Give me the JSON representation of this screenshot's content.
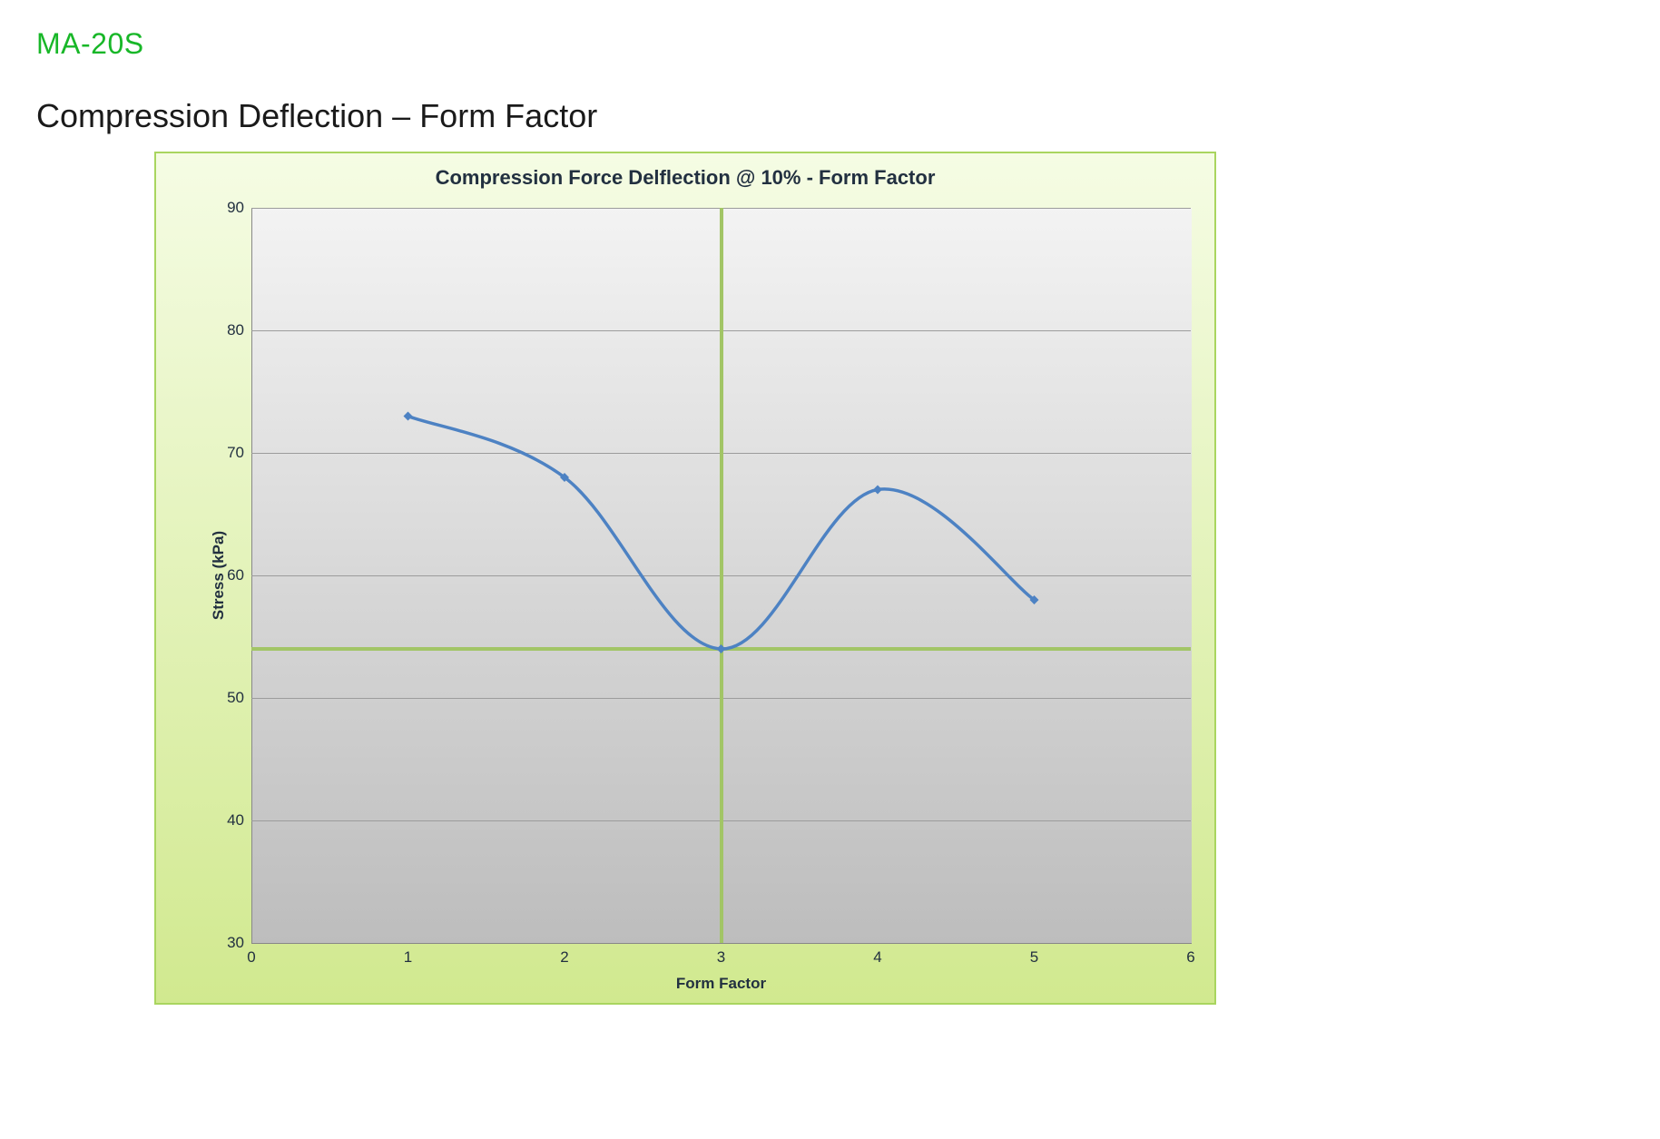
{
  "model_code": "MA-20S",
  "section_title": "Compression Deflection – Form Factor",
  "chart_data": {
    "type": "line",
    "title": "Compression Force Delflection @ 10% - Form Factor",
    "xlabel": "Form Factor",
    "ylabel": "Stress  (kPa)",
    "xlim": [
      0,
      6
    ],
    "ylim": [
      30,
      90
    ],
    "x_ticks": [
      0,
      1,
      2,
      3,
      4,
      5,
      6
    ],
    "y_ticks": [
      30,
      40,
      50,
      60,
      70,
      80,
      90
    ],
    "x": [
      1,
      2,
      3,
      4,
      5
    ],
    "values": [
      73,
      68,
      54,
      67,
      58
    ],
    "crosshair": {
      "x": 3,
      "y": 54
    },
    "line_color": "#4d82c3"
  }
}
